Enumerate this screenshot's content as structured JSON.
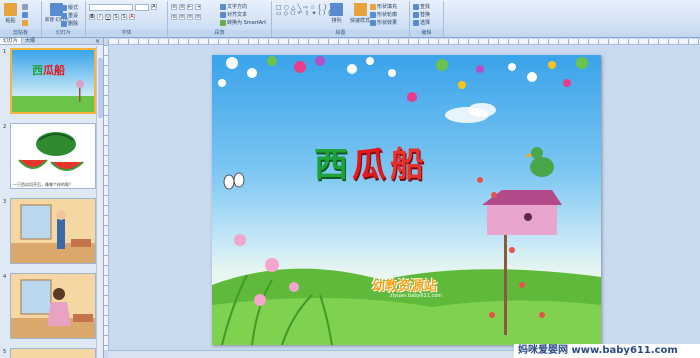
{
  "ribbon": {
    "groups": [
      {
        "label": "剪贴板"
      },
      {
        "label": "幻灯片"
      },
      {
        "label": "字体"
      },
      {
        "label": "段落"
      },
      {
        "label": "绘图"
      },
      {
        "label": "编辑"
      }
    ],
    "buttons": {
      "paste": "粘贴",
      "new_slide": "新建\n幻灯片",
      "layout": "版式",
      "reset": "重设",
      "delete": "删除",
      "text_direction": "文字方向",
      "align_text": "对齐文本",
      "convert_smartart": "转换为 SmartArt",
      "arrange": "排列",
      "quick_styles": "快速样式",
      "shape_fill": "形状填充",
      "shape_outline": "形状轮廓",
      "shape_effects": "形状效果",
      "find": "查找",
      "replace": "替换",
      "select": "选择"
    }
  },
  "panel": {
    "tab_slides": "幻灯片",
    "tab_outline": "大纲",
    "close": "×",
    "slide_numbers": [
      "1",
      "2",
      "3",
      "4",
      "5"
    ],
    "thumb2_caption": "一只西瓜切开后，像哪个样的呢？"
  },
  "slide": {
    "title_chars": [
      "西",
      "瓜",
      "船"
    ],
    "logo_text": "幼教资源站",
    "logo_url": "ziyuan.baby611.com"
  },
  "watermark": "妈咪爱婴网 www.baby611.com",
  "colors": {
    "ribbon_bg": "#d4e3f6",
    "sky": "#3aa3ea",
    "title_green": "#1fa23a",
    "title_red": "#e6181e"
  }
}
